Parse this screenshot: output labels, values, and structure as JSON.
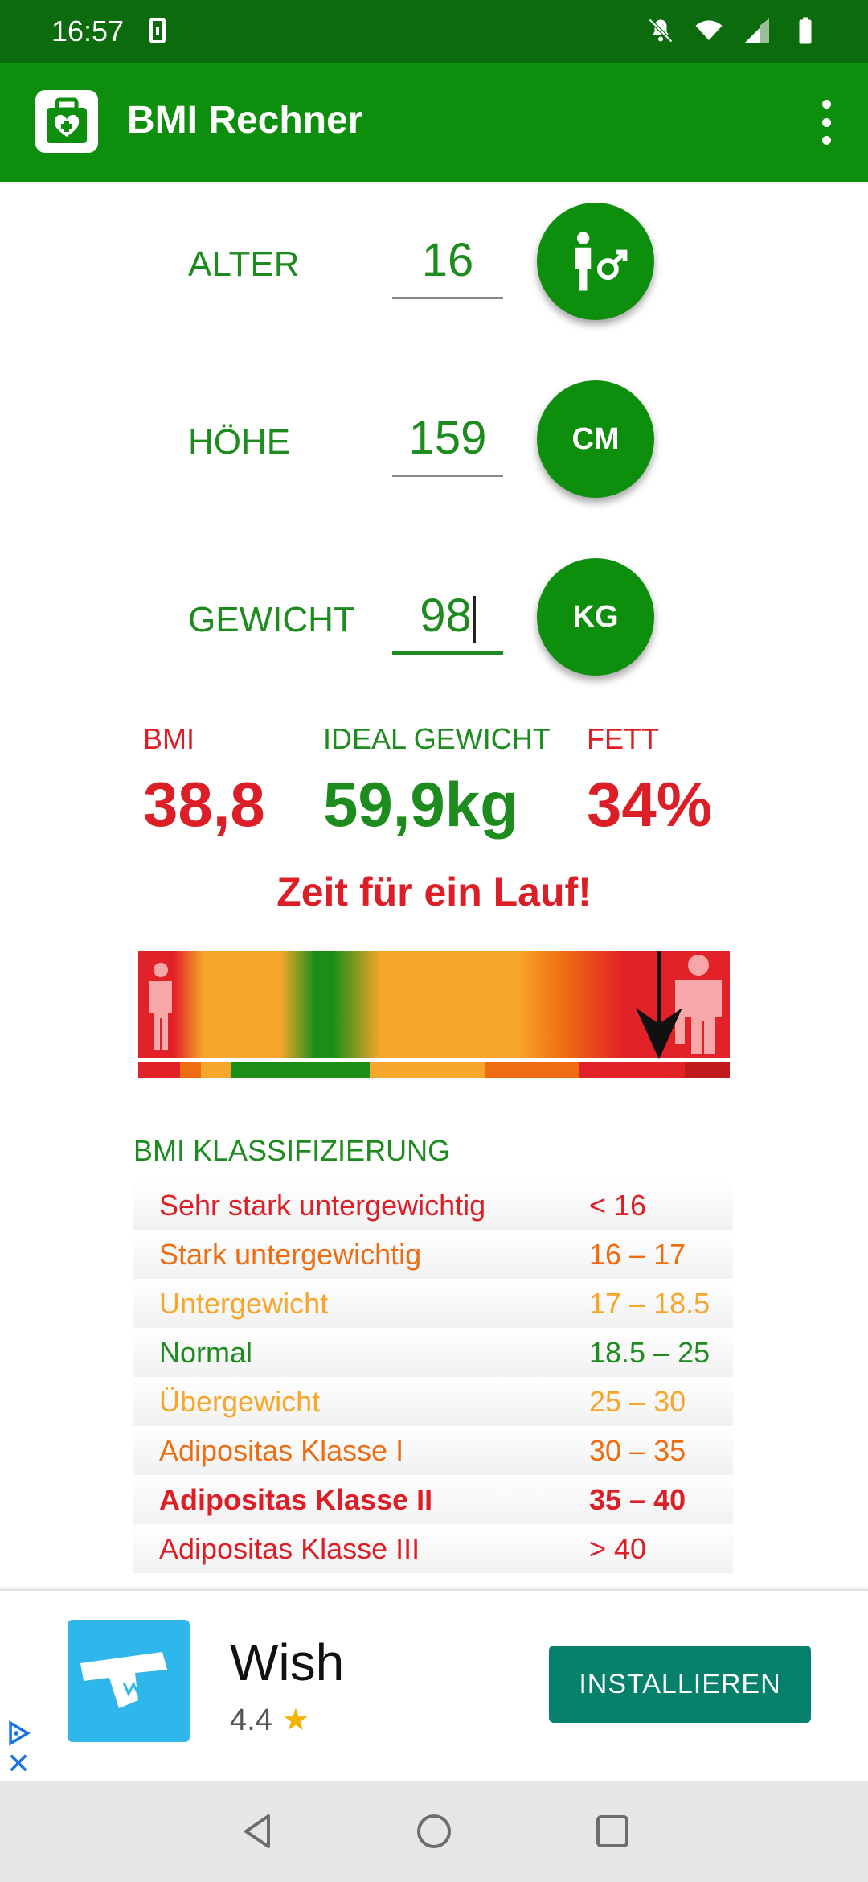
{
  "status_bar": {
    "time": "16:57"
  },
  "app_bar": {
    "title": "BMI Rechner"
  },
  "inputs": {
    "age": {
      "label": "ALTER",
      "value": "16",
      "button": "male-gender"
    },
    "height": {
      "label": "HÖHE",
      "value": "159",
      "button_label": "CM"
    },
    "weight": {
      "label": "GEWICHT",
      "value": "98",
      "button_label": "KG"
    }
  },
  "results": {
    "bmi": {
      "label": "BMI",
      "value": "38,8"
    },
    "ideal": {
      "label": "IDEAL GEWICHT",
      "value": "59,9kg"
    },
    "fat": {
      "label": "FETT",
      "value": "34%"
    },
    "message": "Zeit für ein Lauf!"
  },
  "scale": {
    "bmi_marker": 38.8
  },
  "classification": {
    "title": "BMI KLASSIFIZIERUNG",
    "rows": [
      {
        "name": "Sehr stark untergewichtig",
        "range": "< 16",
        "color": "#dc1f26"
      },
      {
        "name": "Stark untergewichtig",
        "range": "16 – 17",
        "color": "#ee6d12"
      },
      {
        "name": "Untergewicht",
        "range": "17 – 18.5",
        "color": "#f6a62a"
      },
      {
        "name": "Normal",
        "range": "18.5 – 25",
        "color": "#1d8b1d"
      },
      {
        "name": "Übergewicht",
        "range": "25 – 30",
        "color": "#f6a62a"
      },
      {
        "name": "Adipositas Klasse I",
        "range": "30 – 35",
        "color": "#ee6d12"
      },
      {
        "name": "Adipositas Klasse II",
        "range": "35 – 40",
        "color": "#dc1f26"
      },
      {
        "name": "Adipositas Klasse III",
        "range": "> 40",
        "color": "#dc1f26"
      }
    ]
  },
  "ad": {
    "name": "Wish",
    "rating": "4.4",
    "button": "INSTALLIEREN"
  },
  "colors": {
    "primary": "#0d8e0d",
    "dark_primary": "#0c6b0c",
    "red": "#dc1f26",
    "green": "#1d8b1d"
  }
}
